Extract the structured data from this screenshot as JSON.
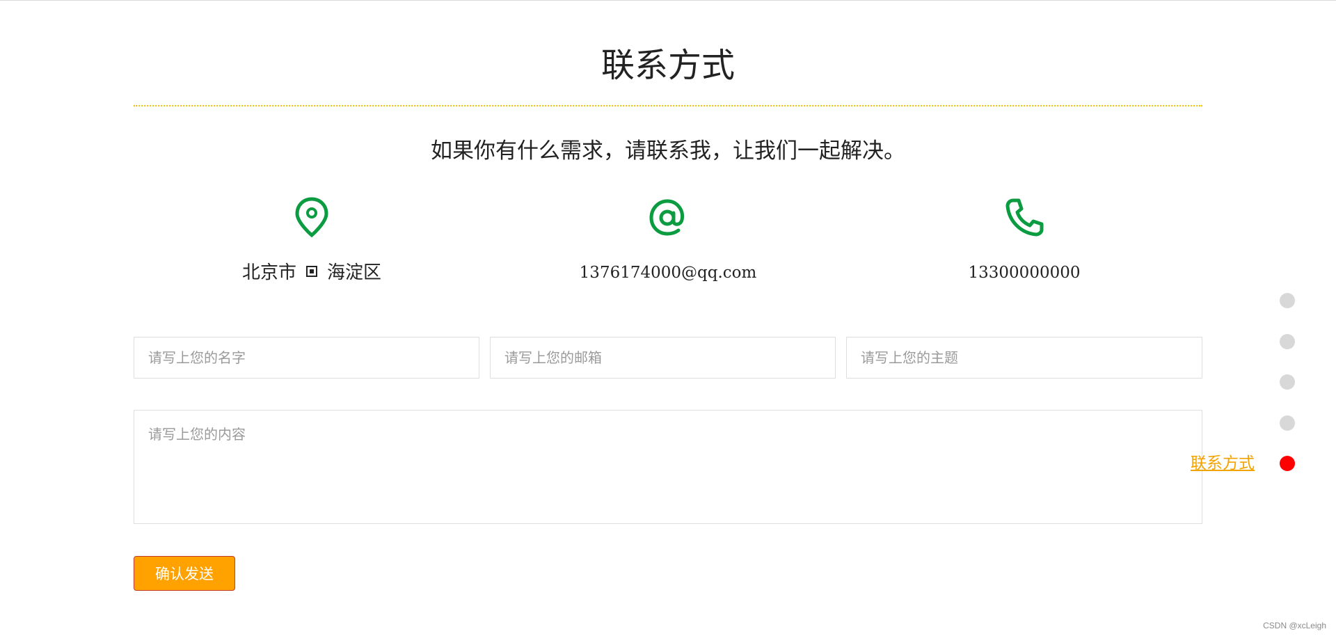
{
  "page": {
    "title": "联系方式",
    "subtitle": "如果你有什么需求，请联系我，让我们一起解决。"
  },
  "contact": {
    "address_city": "北京市",
    "address_district": "海淀区",
    "email": "1376174000@qq.com",
    "phone": "13300000000",
    "icons": [
      "location-pin-icon",
      "at-sign-icon",
      "phone-icon"
    ],
    "icon_color": "#0b9b40"
  },
  "form": {
    "name_placeholder": "请写上您的名字",
    "email_placeholder": "请写上您的邮箱",
    "subject_placeholder": "请写上您的主题",
    "content_placeholder": "请写上您的内容",
    "submit_label": "确认发送",
    "submit_color": "#ffa200"
  },
  "side_nav": {
    "active_label": "联系方式",
    "active_index": 4,
    "dot_count": 5,
    "active_color": "#ff0000",
    "inactive_color": "#d8d8d8",
    "label_color": "#f3a300"
  },
  "watermark": "CSDN @xcLeigh"
}
